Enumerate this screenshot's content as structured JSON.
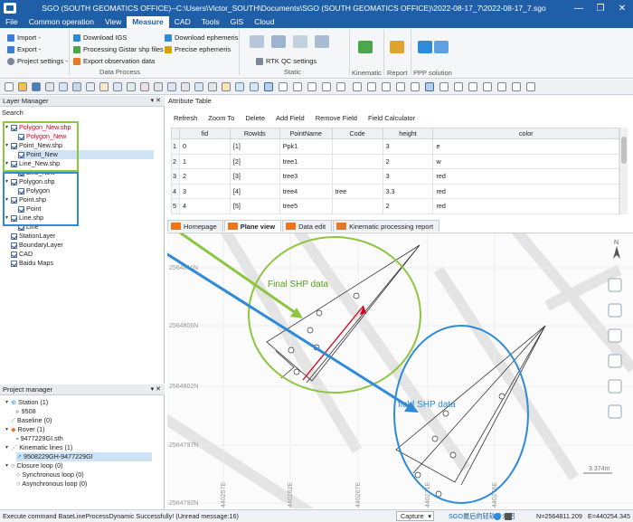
{
  "window": {
    "title": "SGO (SOUTH GEOMATICS OFFICE)--C:\\Users\\Victor_SOUTH\\Documents\\SGO (SOUTH GEOMATICS OFFICE)\\2022-08-17_7\\2022-08-17_7.sgo",
    "minimize": "—",
    "restore": "❐",
    "close": "✕"
  },
  "menu": [
    "File",
    "Common operation",
    "View",
    "Measure",
    "CAD",
    "Tools",
    "GIS",
    "Cloud"
  ],
  "menu_active": "Measure",
  "ribbon": {
    "import": "Import -",
    "export": "Export -",
    "project_settings": "Project settings -",
    "download_igs": "Download IGS",
    "processing_gistar": "Processing Gistar shp files",
    "export_observation": "Export observation data",
    "download_ephemeris": "Download ephemeris",
    "precise_ephemeris": "Precise ephemeris",
    "data_process": "Data Process",
    "rtk_qc": "RTK QC settings",
    "static": "Static",
    "kinematic": "Kinematic",
    "report": "Report",
    "ppp_solution": "PPP solution"
  },
  "layer_manager": {
    "title": "Layer Manager",
    "pin": "▾ ✕",
    "search_label": "Search",
    "items": [
      {
        "label": "Polygon_New.shp",
        "red": true
      },
      {
        "label": "Polygon_New",
        "red": true
      },
      {
        "label": "Point_New.shp",
        "red": false
      },
      {
        "label": "Point_New",
        "red": false
      },
      {
        "label": "Line_New.shp",
        "red": false
      },
      {
        "label": "Line_New",
        "red": false
      },
      {
        "label": "Polygon.shp",
        "red": false
      },
      {
        "label": "Polygon",
        "red": false
      },
      {
        "label": "Point.shp",
        "red": false
      },
      {
        "label": "Point",
        "red": false
      },
      {
        "label": "Line.shp",
        "red": false
      },
      {
        "label": "Line",
        "red": false
      },
      {
        "label": "StationLayer",
        "red": false
      },
      {
        "label": "BoundaryLayer",
        "red": false
      },
      {
        "label": "CAD",
        "red": false
      },
      {
        "label": "Baidu Maps",
        "red": false
      }
    ]
  },
  "project_manager": {
    "title": "Project manager",
    "pin": "▾ ✕",
    "items": [
      "Station (1)",
      "9508",
      "Baseline (0)",
      "Rover (1)",
      "9477229GI.sth",
      "Kinematic lines (1)",
      "9508229GH-9477229GI",
      "Closure loop (0)",
      "Synchronous loop (0)",
      "Asynchronous loop (0)"
    ]
  },
  "attribute_table": {
    "title": "Attribute Table",
    "actions": [
      "Refresh",
      "Zoom To",
      "Delete",
      "Add Field",
      "Remove Field",
      "Field Calculator"
    ],
    "columns": [
      "fid",
      "RowIds",
      "PointName",
      "Code",
      "height",
      "color"
    ],
    "rows": [
      [
        "0",
        "[1]",
        "Ppk1",
        "",
        "3",
        "e"
      ],
      [
        "1",
        "[2]",
        "tree1",
        "",
        "2",
        "w"
      ],
      [
        "2",
        "[3]",
        "tree3",
        "",
        "3",
        "red"
      ],
      [
        "3",
        "[4]",
        "tree4",
        "tree",
        "3.3",
        "red"
      ],
      [
        "4",
        "[5]",
        "tree5",
        "",
        "2",
        "red"
      ]
    ],
    "row_numbers": [
      "1",
      "2",
      "3",
      "4",
      "5"
    ]
  },
  "tabs": [
    {
      "label": "Homepage",
      "active": false
    },
    {
      "label": "Plane view",
      "active": true
    },
    {
      "label": "Data edit",
      "active": false
    },
    {
      "label": "Kinematic processing report",
      "active": false
    }
  ],
  "map": {
    "y_ticks": [
      "2564811N",
      "2564806N",
      "2564802N",
      "2564797N",
      "2564792N"
    ],
    "x_ticks": [
      "440257E",
      "440262E",
      "440267E",
      "440271E",
      "440276E"
    ],
    "north_label": "N",
    "scale_label": "3.374m",
    "final_label": "Final SHP data",
    "field_label": "field SHP data"
  },
  "colors": {
    "title_blue": "#1f5fa8",
    "green": "#8cc63f",
    "blue": "#2f8ad8",
    "red": "#d0021b"
  },
  "status": {
    "message": "Execute command BaseLineProcessDynamic Successfully! (Unread message:16)",
    "capture": "Capture",
    "link": "SGO最后的轻软件介绍",
    "north": "N=2564811.209",
    "east": "E=440254.345"
  }
}
